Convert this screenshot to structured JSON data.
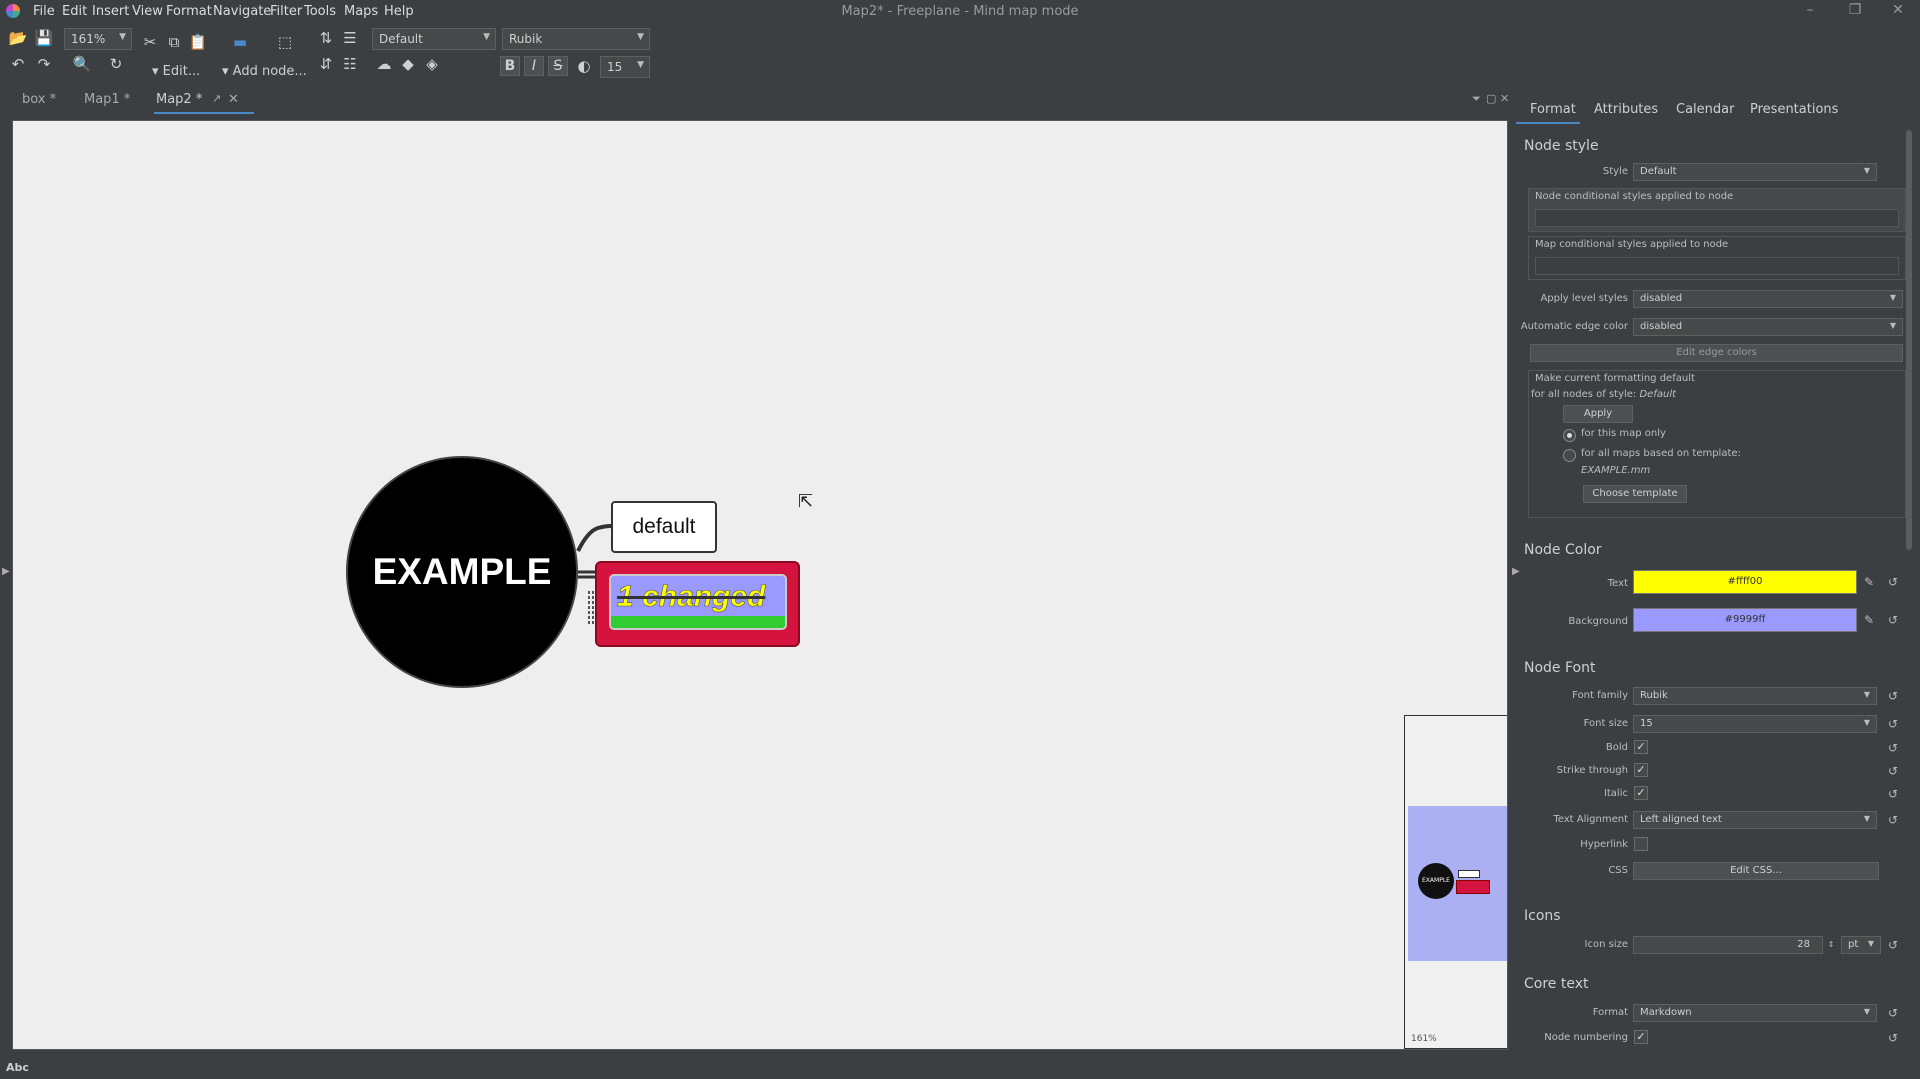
{
  "window": {
    "title": "Map2* - Freeplane - Mind map mode"
  },
  "menu": [
    "File",
    "Edit",
    "Insert",
    "View",
    "Format",
    "Navigate",
    "Filter",
    "Tools",
    "Maps",
    "Help"
  ],
  "toolbar": {
    "zoom": "161%",
    "edit_label": "▾ Edit...",
    "add_node_label": "▾ Add node...",
    "style_combo": "Default",
    "font_combo": "Rubik",
    "font_size": "15",
    "bold": "B",
    "italic": "I",
    "strike": "S"
  },
  "tabs": [
    {
      "label": "box *"
    },
    {
      "label": "Map1 *"
    },
    {
      "label": "Map2 *"
    }
  ],
  "map": {
    "root_text": "EXAMPLE",
    "child1_text": "default",
    "child2_text": "1 changed",
    "minimap_zoom": "161%"
  },
  "panel": {
    "tabs": [
      "Format",
      "Attributes",
      "Calendar",
      "Presentations"
    ],
    "node_style": {
      "title": "Node style",
      "style_label": "Style",
      "style_value": "Default",
      "node_cond_label": "Node conditional styles applied to node",
      "map_cond_label": "Map conditional styles applied to node",
      "apply_level_label": "Apply level styles",
      "apply_level_value": "disabled",
      "auto_edge_label": "Automatic edge color",
      "auto_edge_value": "disabled",
      "edit_edge_colors": "Edit edge colors",
      "make_default_line1": "Make current formatting default",
      "make_default_line2": "for all nodes of style: ",
      "make_default_style": "Default",
      "apply_btn": "Apply",
      "radio1": "for this map only",
      "radio2": "for all maps based on template:",
      "template_name": "EXAMPLE.mm",
      "choose_template": "Choose template"
    },
    "node_color": {
      "title": "Node Color",
      "text_label": "Text",
      "text_value": "#ffff00",
      "bg_label": "Background",
      "bg_value": "#9999ff"
    },
    "node_font": {
      "title": "Node Font",
      "family_label": "Font family",
      "family_value": "Rubik",
      "size_label": "Font size",
      "size_value": "15",
      "bold_label": "Bold",
      "strike_label": "Strike through",
      "italic_label": "Italic",
      "align_label": "Text Alignment",
      "align_value": "Left aligned text",
      "hyperlink_label": "Hyperlink",
      "css_label": "CSS",
      "css_btn": "Edit CSS..."
    },
    "icons": {
      "title": "Icons",
      "size_label": "Icon size",
      "size_value": "28",
      "unit": "pt"
    },
    "core_text": {
      "title": "Core text",
      "format_label": "Format",
      "format_value": "Markdown",
      "numbering_label": "Node numbering"
    }
  },
  "status": {
    "left": "Abc"
  },
  "colors": {
    "accent": "#4a88c7",
    "node_text": "#ffff00",
    "node_bg": "#9999ff",
    "node_border": "#d4143e"
  }
}
